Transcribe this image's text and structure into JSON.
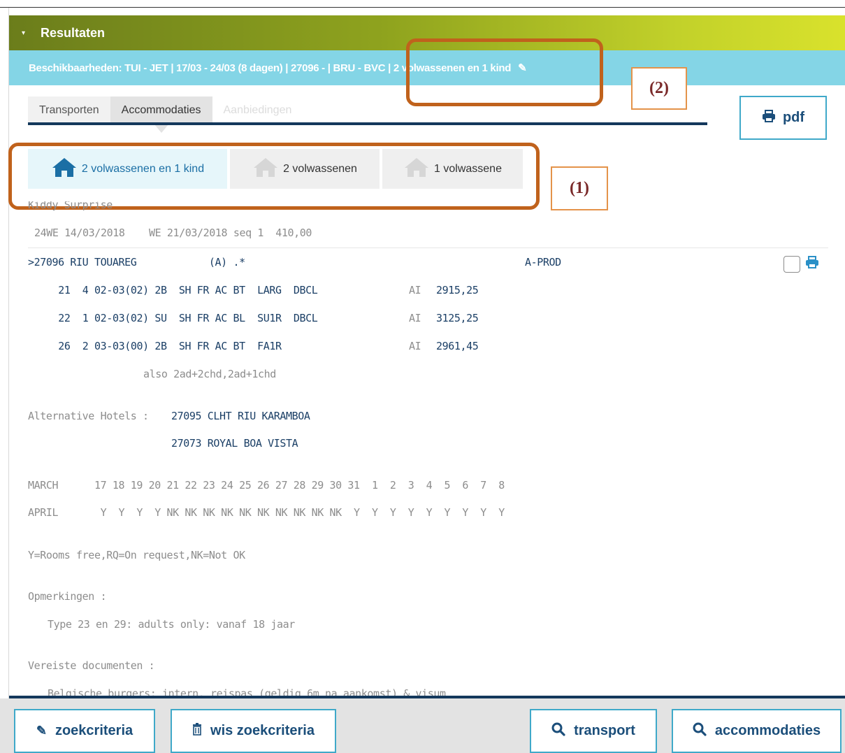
{
  "results": {
    "caret": "▾",
    "title": "Resultaten"
  },
  "availability": {
    "text": "Beschikbaarheden: TUI - JET | 17/03 - 24/03 (8 dagen) | 27096 - | BRU - BVC | 2 volwassenen en 1 kind",
    "edit_icon": "pencil-icon"
  },
  "tabs": [
    {
      "label": "Transporten",
      "state": "normal"
    },
    {
      "label": "Accommodaties",
      "state": "active"
    },
    {
      "label": "Aanbiedingen",
      "state": "disabled"
    }
  ],
  "pdf_button": {
    "label": "pdf",
    "icon": "printer-icon"
  },
  "rooms": [
    {
      "label": "2 volwassenen en 1 kind",
      "active": true
    },
    {
      "label": "2 volwassenen",
      "active": false
    },
    {
      "label": "1 volwassene",
      "active": false
    }
  ],
  "annotations": {
    "label1": "(1)",
    "label2": "(2)"
  },
  "result": {
    "package": "Kiddy Surprise",
    "period_line": "24WE 14/03/2018    WE 21/03/2018 seq 1  410,00",
    "hotel_line": ">27096 RIU TOUAREG            (A) .*",
    "prod": "A-PROD",
    "room_lines": [
      {
        "code": "  21  4 02-03(02) 2B  SH FR AC BT  LARG  DBCL",
        "board": "AI",
        "price": "2915,25"
      },
      {
        "code": "  22  1 02-03(02) SU  SH FR AC BL  SU1R  DBCL",
        "board": "AI",
        "price": "3125,25"
      },
      {
        "code": "  26  2 03-03(00) 2B  SH FR AC BT  FA1R",
        "board": "AI",
        "price": "2961,45"
      }
    ],
    "also": "also 2ad+2chd,2ad+1chd",
    "alt_label": "Alternative Hotels :",
    "alt_hotels": [
      "27095 CLHT RIU KARAMBOA",
      "27073 ROYAL BOA VISTA"
    ],
    "calendar_month1": "MARCH      17 18 19 20 21 22 23 24 25 26 27 28 29 30 31  1  2  3  4  5  6  7  8",
    "calendar_month2": "APRIL       Y  Y  Y  Y NK NK NK NK NK NK NK NK NK NK  Y  Y  Y  Y  Y  Y  Y  Y  Y",
    "legend": "Y=Rooms free,RQ=On request,NK=Not OK",
    "remarks_label": "Opmerkingen :",
    "remarks": "Type 23 en 29: adults only: vanaf 18 jaar",
    "docs_label": "Vereiste documenten :",
    "docs": "Belgische burgers: intern. reispas (geldig 6m na aankomst) & visum"
  },
  "bottom_buttons": [
    {
      "label": "zoekcriteria",
      "icon": "pencil-icon"
    },
    {
      "label": "wis zoekcriteria",
      "icon": "trash-icon"
    },
    {
      "label": "transport",
      "icon": "search-icon"
    },
    {
      "label": "accommodaties",
      "icon": "search-icon"
    }
  ],
  "colors": {
    "accent": "#3fa9c9",
    "navy": "#14385c",
    "annotation": "#c0621c",
    "availability_bar": "#84d5e6"
  }
}
